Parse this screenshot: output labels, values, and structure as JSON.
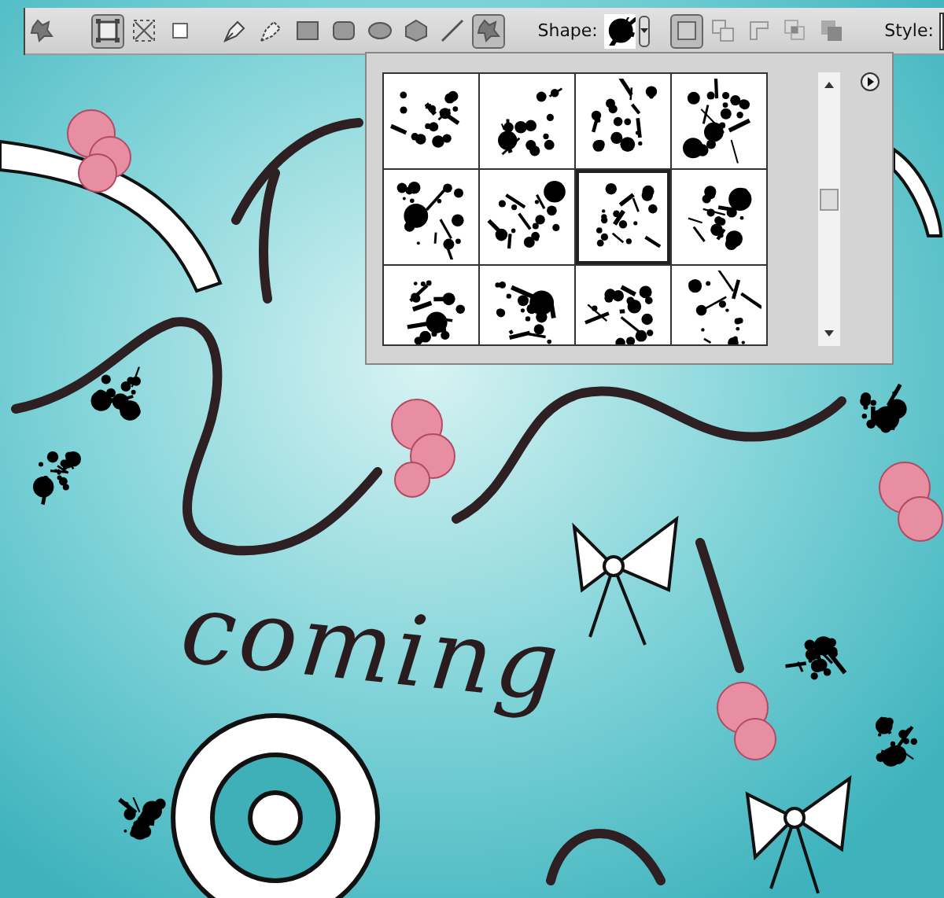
{
  "options_bar": {
    "preset_tools": [
      {
        "kind": "custom-shape",
        "selected": false
      }
    ],
    "modes": [
      {
        "kind": "shape-layers",
        "selected": true
      },
      {
        "kind": "paths",
        "selected": false
      },
      {
        "kind": "fill-pixels",
        "selected": false
      }
    ],
    "tools": [
      {
        "kind": "pen",
        "selected": false
      },
      {
        "kind": "freeform-pen",
        "selected": false
      },
      {
        "kind": "rectangle",
        "selected": false
      },
      {
        "kind": "rounded-rectangle",
        "selected": false
      },
      {
        "kind": "ellipse",
        "selected": false
      },
      {
        "kind": "polygon",
        "selected": false
      },
      {
        "kind": "line",
        "selected": false
      },
      {
        "kind": "custom-shape",
        "selected": true
      }
    ],
    "shape_label": "Shape:",
    "combine_modes": [
      {
        "kind": "new",
        "selected": true
      },
      {
        "kind": "add",
        "selected": false
      },
      {
        "kind": "subtract",
        "selected": false
      },
      {
        "kind": "intersect",
        "selected": false
      },
      {
        "kind": "exclude",
        "selected": false
      }
    ],
    "style_label": "Style:"
  },
  "shape_picker": {
    "swatches": [
      {
        "selected": false
      },
      {
        "selected": false
      },
      {
        "selected": false
      },
      {
        "selected": false
      },
      {
        "selected": false
      },
      {
        "selected": false
      },
      {
        "selected": true
      },
      {
        "selected": false
      },
      {
        "selected": false
      },
      {
        "selected": false
      },
      {
        "selected": false
      },
      {
        "selected": false
      }
    ]
  },
  "canvas": {
    "lettering": "coming"
  }
}
